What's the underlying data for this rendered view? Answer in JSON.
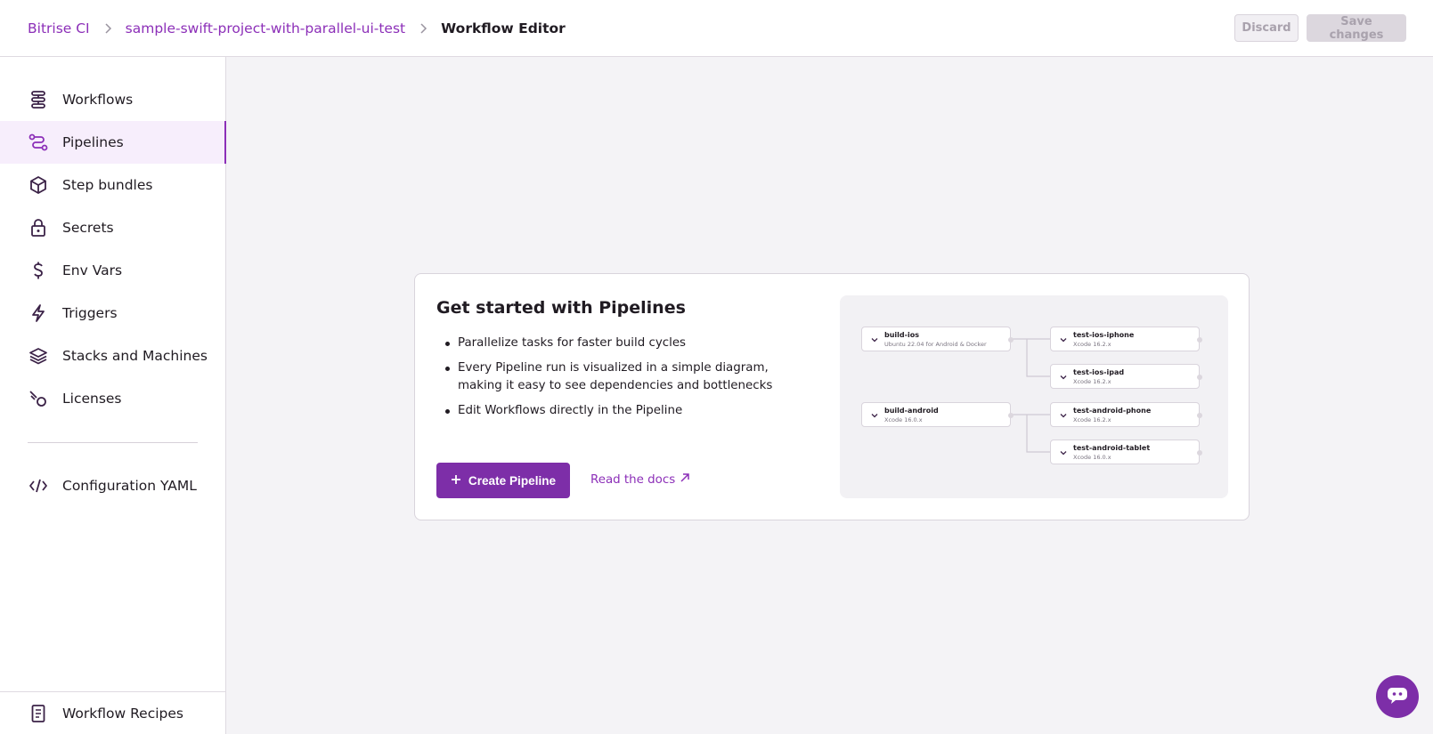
{
  "header": {
    "breadcrumbs": [
      "Bitrise CI",
      "sample-swift-project-with-parallel-ui-test",
      "Workflow Editor"
    ],
    "discard_label": "Discard",
    "save_label": "Save changes"
  },
  "sidebar": {
    "items": [
      {
        "label": "Workflows",
        "icon": "workflows-icon"
      },
      {
        "label": "Pipelines",
        "icon": "pipelines-icon",
        "active": true
      },
      {
        "label": "Step bundles",
        "icon": "step-bundle-icon"
      },
      {
        "label": "Secrets",
        "icon": "lock-icon"
      },
      {
        "label": "Env Vars",
        "icon": "dollar-icon"
      },
      {
        "label": "Triggers",
        "icon": "lightning-icon"
      },
      {
        "label": "Stacks and Machines",
        "icon": "stack-icon"
      },
      {
        "label": "Licenses",
        "icon": "license-icon"
      },
      {
        "label": "Configuration YAML",
        "icon": "code-icon"
      }
    ],
    "footer_label": "Workflow Recipes"
  },
  "card": {
    "title": "Get started with Pipelines",
    "bullets": [
      "Parallelize tasks for faster build cycles",
      "Every Pipeline run is visualized in a simple diagram, making it easy to see dependencies and bottlenecks",
      "Edit Workflows directly in the Pipeline"
    ],
    "create_label": "Create Pipeline",
    "docs_label": "Read the docs"
  },
  "diagram": {
    "nodes": [
      {
        "title": "build-ios",
        "subtitle": "Ubuntu 22.04 for Android & Docker"
      },
      {
        "title": "test-ios-iphone",
        "subtitle": "Xcode 16.2.x"
      },
      {
        "title": "test-ios-ipad",
        "subtitle": "Xcode 16.2.x"
      },
      {
        "title": "build-android",
        "subtitle": "Xcode 16.0.x"
      },
      {
        "title": "test-android-phone",
        "subtitle": "Xcode 16.2.x"
      },
      {
        "title": "test-android-tablet",
        "subtitle": "Xcode 16.0.x"
      }
    ]
  },
  "colors": {
    "brand": "#8c2fb8",
    "primary_button": "#7d2ea8",
    "active_nav_bg": "#f7eefc"
  }
}
